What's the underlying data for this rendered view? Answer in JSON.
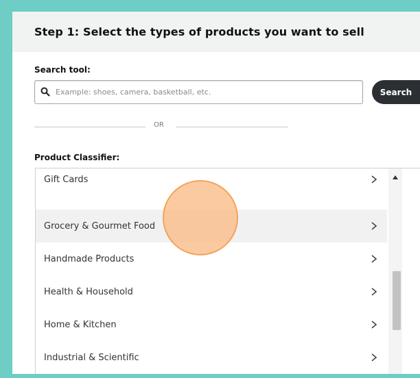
{
  "step": {
    "title": "Step 1: Select the types of products you want to sell"
  },
  "search": {
    "label": "Search tool:",
    "placeholder": "Example: shoes, camera, basketball, etc.",
    "value": "",
    "button_label": "Search",
    "icon": "search-icon"
  },
  "divider": {
    "text": "OR"
  },
  "classifier": {
    "label": "Product Classifier:",
    "items": [
      {
        "label": "Gift Cards",
        "icon": "chevron-right-icon"
      },
      {
        "label": "Grocery & Gourmet Food",
        "icon": "chevron-right-icon",
        "highlighted": true
      },
      {
        "label": "Handmade Products",
        "icon": "chevron-right-icon"
      },
      {
        "label": "Health & Household",
        "icon": "chevron-right-icon"
      },
      {
        "label": "Home & Kitchen",
        "icon": "chevron-right-icon"
      },
      {
        "label": "Industrial & Scientific",
        "icon": "chevron-right-icon"
      }
    ]
  },
  "colors": {
    "border_frame": "#6ecdc4",
    "header_bg": "#f1f2f2",
    "button_bg": "#2b2f33",
    "cursor_highlight": "#fbb880"
  }
}
